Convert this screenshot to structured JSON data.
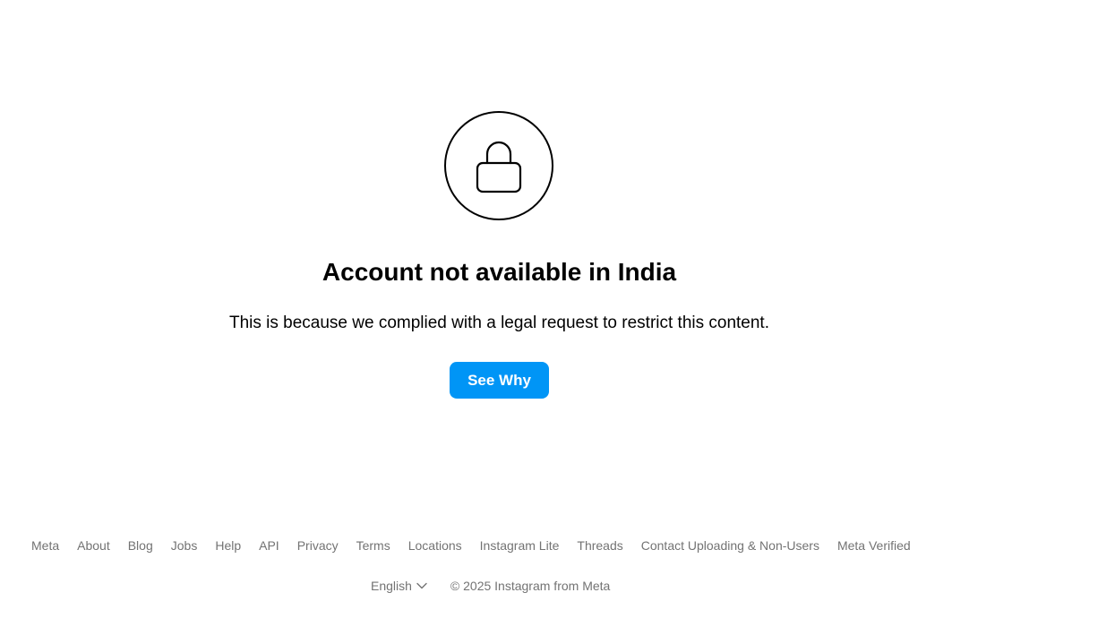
{
  "main": {
    "lock_icon": "lock-icon",
    "title": "Account not available in India",
    "message": "This is because we complied with a legal request to restrict this content.",
    "see_why_label": "See Why",
    "accent_color": "#0095f6"
  },
  "footer": {
    "links": [
      "Meta",
      "About",
      "Blog",
      "Jobs",
      "Help",
      "API",
      "Privacy",
      "Terms",
      "Locations",
      "Instagram Lite",
      "Threads",
      "Contact Uploading & Non-Users",
      "Meta Verified"
    ],
    "language": "English",
    "language_icon": "chevron-down-icon",
    "copyright": "© 2025 Instagram from Meta"
  }
}
